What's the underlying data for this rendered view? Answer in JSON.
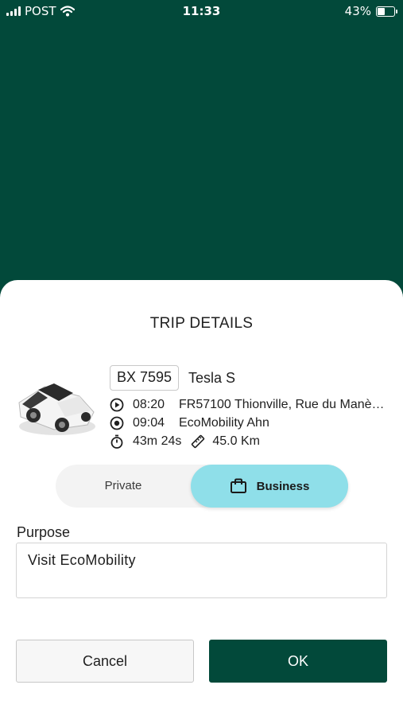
{
  "status_bar": {
    "carrier": "POST",
    "time": "11:33",
    "battery_percent": "43%",
    "battery_level": 0.43,
    "icons": [
      "signal-icon",
      "wifi-icon",
      "battery-icon"
    ]
  },
  "trip": {
    "title": "TRIP DETAILS",
    "vehicle_plate": "BX 7595",
    "vehicle_model": "Tesla S",
    "start": {
      "time": "08:20",
      "address": "FR57100 Thionville, Rue du Manè…",
      "icon": "play-circle-icon"
    },
    "end": {
      "time": "09:04",
      "address": "EcoMobility Ahn",
      "icon": "target-circle-icon"
    },
    "duration": "43m 24s",
    "distance": "45.0 Km",
    "icons": {
      "duration": "stopwatch-icon",
      "distance": "ruler-icon",
      "business": "briefcase-icon",
      "vehicle": "car-image"
    }
  },
  "trip_type": {
    "options": [
      "Private",
      "Business"
    ],
    "selected": "Business"
  },
  "purpose": {
    "label": "Purpose",
    "value": "Visit EcoMobility"
  },
  "actions": {
    "cancel_label": "Cancel",
    "ok_label": "OK"
  },
  "colors": {
    "header_bg": "#02493a",
    "primary": "#02493a",
    "selected_segment": "#8fdfe9",
    "sheet_bg": "#ffffff"
  }
}
